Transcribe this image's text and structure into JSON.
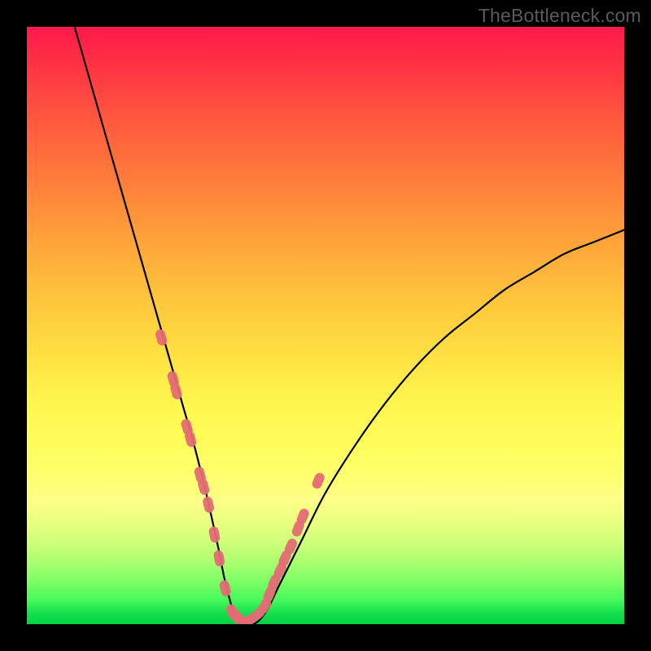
{
  "watermark": "TheBottleneck.com",
  "colors": {
    "frame": "#000000",
    "line": "#000000",
    "marker": "#e46b74",
    "gradient_top": "#ff1a4b",
    "gradient_mid": "#ffe443",
    "gradient_bottom": "#00d246"
  },
  "chart_data": {
    "type": "line",
    "title": "",
    "xlabel": "",
    "ylabel": "",
    "xlim": [
      0,
      100
    ],
    "ylim": [
      0,
      100
    ],
    "grid": false,
    "series": [
      {
        "name": "bottleneck-curve",
        "x": [
          8,
          10,
          12,
          14,
          16,
          18,
          20,
          22,
          24,
          26,
          28,
          30,
          32,
          33,
          34,
          35,
          36,
          38,
          40,
          42,
          44,
          46,
          50,
          55,
          60,
          65,
          70,
          75,
          80,
          85,
          90,
          95,
          100
        ],
        "values": [
          100,
          93,
          86,
          79,
          72,
          65,
          58,
          51,
          44,
          37,
          30,
          22,
          13,
          8,
          4,
          1,
          0,
          0,
          2,
          6,
          10,
          14,
          22,
          30,
          37,
          43,
          48,
          52,
          56,
          59,
          62,
          64,
          66
        ]
      }
    ],
    "markers": {
      "name": "highlight-dots",
      "color": "#e46b74",
      "x": [
        22.5,
        24.5,
        25.0,
        26.8,
        27.4,
        29.0,
        29.6,
        30.4,
        31.4,
        32.2,
        33.2,
        34.4,
        35.0,
        36.0,
        37.0,
        38.6,
        39.8,
        40.6,
        41.4,
        42.4,
        43.2,
        44.2,
        45.4,
        46.2,
        48.8
      ],
      "values": [
        48,
        41,
        39,
        33,
        31,
        25,
        23,
        20,
        15,
        11,
        6,
        2,
        1.5,
        0.5,
        0.6,
        1.6,
        3,
        5,
        7,
        9,
        11,
        13,
        16,
        18,
        24
      ]
    }
  }
}
